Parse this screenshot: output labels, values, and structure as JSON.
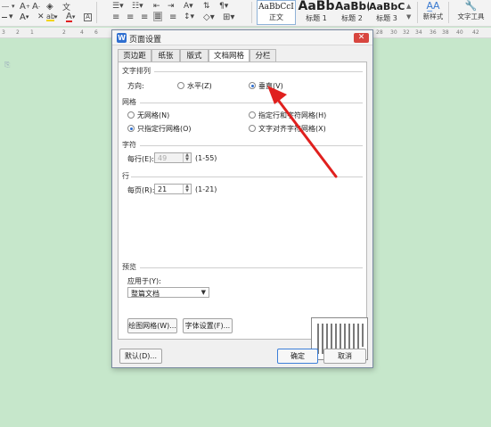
{
  "ribbon": {
    "styles": [
      {
        "sample": "AaBbCcI",
        "name": "正文"
      },
      {
        "sample": "AaBb",
        "name": "标题 1"
      },
      {
        "sample": "AaBb(",
        "name": "标题 2"
      },
      {
        "sample": "AaBbC",
        "name": "标题 3"
      }
    ],
    "new_style_label": "新样式",
    "text_tools_label": "文字工具"
  },
  "dialog": {
    "title": "页面设置",
    "tabs": [
      "页边距",
      "纸张",
      "版式",
      "文档网格",
      "分栏"
    ],
    "active_tab": "文档网格",
    "text_direction": {
      "group_title": "文字排列",
      "direction_label": "方向:",
      "horizontal_label": "水平(Z)",
      "vertical_label": "垂直(V)",
      "selected": "垂直(V)"
    },
    "grid": {
      "group_title": "网格",
      "options": [
        {
          "label": "无网格(N)",
          "selected": false
        },
        {
          "label": "只指定行网格(O)",
          "selected": true
        },
        {
          "label": "指定行和字符网格(H)",
          "selected": false
        },
        {
          "label": "文字对齐字符网格(X)",
          "selected": false
        }
      ]
    },
    "chars": {
      "group_title": "字符",
      "per_line_label": "每行(E):",
      "per_line_value": "49",
      "per_line_range": "(1-55)"
    },
    "lines": {
      "group_title": "行",
      "per_page_label": "每页(R):",
      "per_page_value": "21",
      "per_page_range": "(1-21)"
    },
    "preview": {
      "group_title": "预览",
      "apply_to_label": "应用于(Y):",
      "apply_to_value": "整篇文档"
    },
    "buttons": {
      "draw_grid": "绘图网格(W)...",
      "font_settings": "字体设置(F)...",
      "default": "默认(D)...",
      "ok": "确定",
      "cancel": "取消"
    }
  },
  "colors": {
    "doc_background": "#c6e7cb",
    "accent": "#2f6fd0",
    "annotation": "#e0201e"
  }
}
